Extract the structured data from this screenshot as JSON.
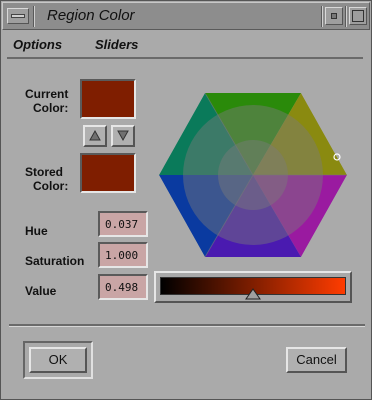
{
  "window": {
    "title": "Region Color"
  },
  "menu": {
    "options": "Options",
    "sliders": "Sliders"
  },
  "labels": {
    "current_color": [
      "Current",
      "Color:"
    ],
    "stored_color": [
      "Stored",
      "Color:"
    ],
    "hue": "Hue",
    "saturation": "Saturation",
    "value": "Value"
  },
  "values": {
    "hue": "0.037",
    "saturation": "1.000",
    "value": "0.498"
  },
  "value_slider": {
    "fraction": 0.498
  },
  "colors": {
    "current": "#7f1e00",
    "stored": "#7f1e00",
    "slider_max": "#ff3c00"
  },
  "buttons": {
    "ok": "OK",
    "cancel": "Cancel"
  },
  "icons": {
    "up": "up-triangle",
    "down": "down-triangle",
    "window_menu": "window-menu-bar"
  }
}
